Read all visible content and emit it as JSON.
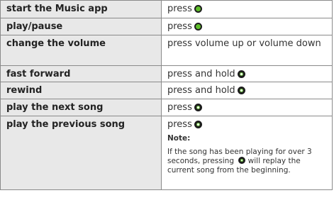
{
  "rows": [
    {
      "action": "start the Music app",
      "instruction": "press",
      "button": "filled"
    },
    {
      "action": "play/pause",
      "instruction": "press",
      "button": "filled"
    },
    {
      "action": "change the volume",
      "instruction": "press volume up or volume down",
      "button": ""
    },
    {
      "action": "fast forward",
      "instruction": "press and hold",
      "button": "ring"
    },
    {
      "action": "rewind",
      "instruction": "press and hold",
      "button": "ring"
    },
    {
      "action": "play the next song",
      "instruction": "press",
      "button": "ring"
    },
    {
      "action": "play the previous song",
      "instruction": "press",
      "button": "ring"
    }
  ],
  "note": {
    "label": "Note:",
    "text_before": "If the song has been playing for over 3 seconds, pressing",
    "text_after": "will replay the current song from the beginning."
  },
  "colors": {
    "button_green": "#5ebf2a",
    "left_cell_bg": "#e8e8e8",
    "border": "#8a8a8a"
  },
  "icons": {
    "filled": "center-button-icon",
    "ring": "click-wheel-ring-icon"
  }
}
